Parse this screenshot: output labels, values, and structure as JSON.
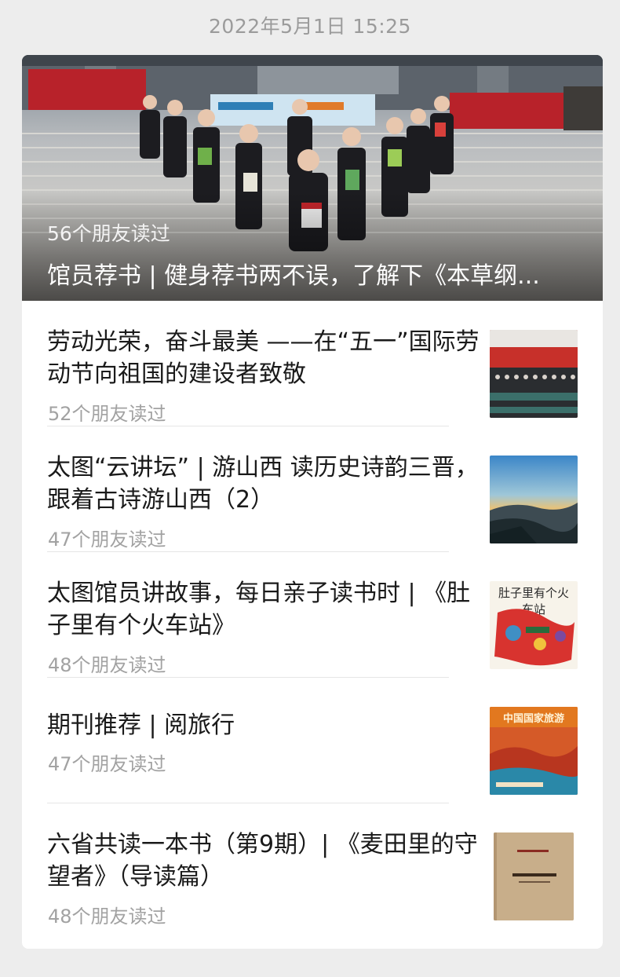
{
  "timestamp": "2022年5月1日  15:25",
  "hero": {
    "reads": "56个朋友读过",
    "title": "馆员荐书 | 健身荐书两不误，了解下《本草纲..."
  },
  "articles": [
    {
      "title": "劳动光荣，奋斗最美 ——在“五一”国际劳动节向祖国的建设者致敬",
      "reads": "52个朋友读过"
    },
    {
      "title": "太图“云讲坛” | 游山西 读历史诗韵三晋，跟着古诗游山西（2）",
      "reads": "47个朋友读过"
    },
    {
      "title": "太图馆员讲故事，每日亲子读书时 | 《肚子里有个火车站》",
      "reads": "48个朋友读过"
    },
    {
      "title": "期刊推荐 | 阅旅行",
      "reads": "47个朋友读过"
    },
    {
      "title": "六省共读一本书（第9期）| 《麦田里的守望者》（导读篇）",
      "reads": "48个朋友读过"
    }
  ],
  "thumb_texts": {
    "train_book": "肚子里有个火车站",
    "magazine": "中国国家旅游"
  }
}
